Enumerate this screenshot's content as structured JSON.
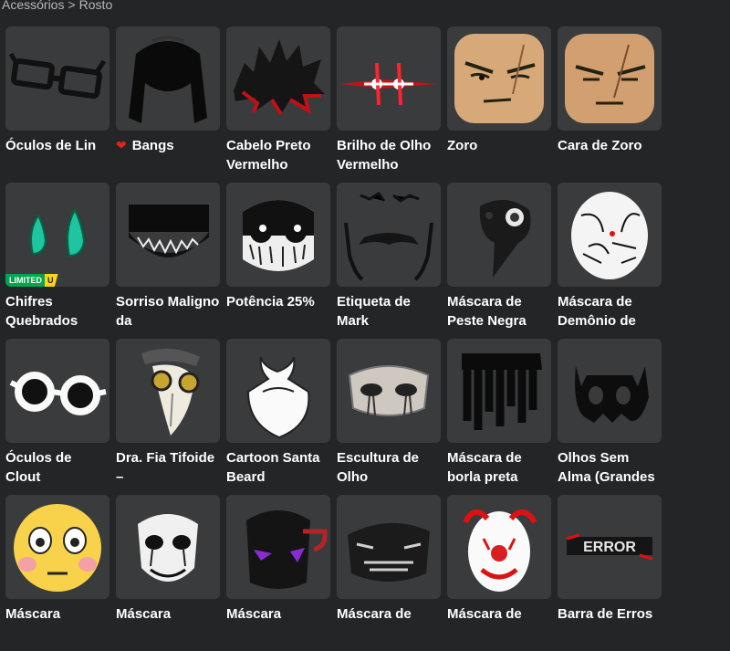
{
  "breadcrumb": {
    "parent": "Acessórios",
    "separator": ">",
    "current": "Rosto"
  },
  "items": [
    {
      "name": "Óculos de Lin",
      "icon": "glasses-icon",
      "favorited": false
    },
    {
      "name": "Bangs",
      "icon": "bangs-hair-icon",
      "favorited": true
    },
    {
      "name": "Cabelo Preto Vermelho",
      "icon": "spiky-hair-icon",
      "favorited": false
    },
    {
      "name": "Brilho de Olho Vermelho",
      "icon": "red-eye-glow-icon",
      "favorited": false
    },
    {
      "name": "Zoro",
      "icon": "zoro-face-icon",
      "favorited": false
    },
    {
      "name": "Cara de Zoro",
      "icon": "zoro-face-scar-icon",
      "favorited": false
    },
    {
      "name": "Chifres Quebrados",
      "icon": "horns-icon",
      "favorited": false,
      "limited": {
        "label": "LIMITED",
        "tag": "U"
      }
    },
    {
      "name": "Sorriso Maligno da",
      "icon": "evil-smile-icon",
      "favorited": false
    },
    {
      "name": "Potência 25%",
      "icon": "skull-face-icon",
      "favorited": false
    },
    {
      "name": "Etiqueta de Mark",
      "icon": "mustache-icon",
      "favorited": false
    },
    {
      "name": "Máscara de Peste Negra",
      "icon": "plague-mask-icon",
      "favorited": false
    },
    {
      "name": "Máscara de Demônio de",
      "icon": "demon-mask-icon",
      "favorited": false
    },
    {
      "name": "Óculos de Clout",
      "icon": "clout-goggles-icon",
      "favorited": false
    },
    {
      "name": "Dra. Fia Tifoide –",
      "icon": "plague-doctor-icon",
      "favorited": false
    },
    {
      "name": "Cartoon Santa Beard",
      "icon": "beard-icon",
      "favorited": false
    },
    {
      "name": "Escultura de Olho",
      "icon": "eye-sculpture-mask-icon",
      "favorited": false
    },
    {
      "name": "Máscara de borla preta",
      "icon": "tassel-mask-icon",
      "favorited": false
    },
    {
      "name": "Olhos Sem Alma (Grandes",
      "icon": "soulless-eyes-icon",
      "favorited": false
    },
    {
      "name": "Máscara",
      "icon": "flushed-face-icon",
      "favorited": false
    },
    {
      "name": "Máscara",
      "icon": "white-mask-icon",
      "favorited": false
    },
    {
      "name": "Máscara",
      "icon": "hooded-mask-icon",
      "favorited": false
    },
    {
      "name": "Máscara de",
      "icon": "samurai-mask-icon",
      "favorited": false
    },
    {
      "name": "Máscara de",
      "icon": "clown-mask-icon",
      "favorited": false
    },
    {
      "name": "Barra de Erros",
      "icon": "error-bar-icon",
      "favorited": false
    }
  ]
}
